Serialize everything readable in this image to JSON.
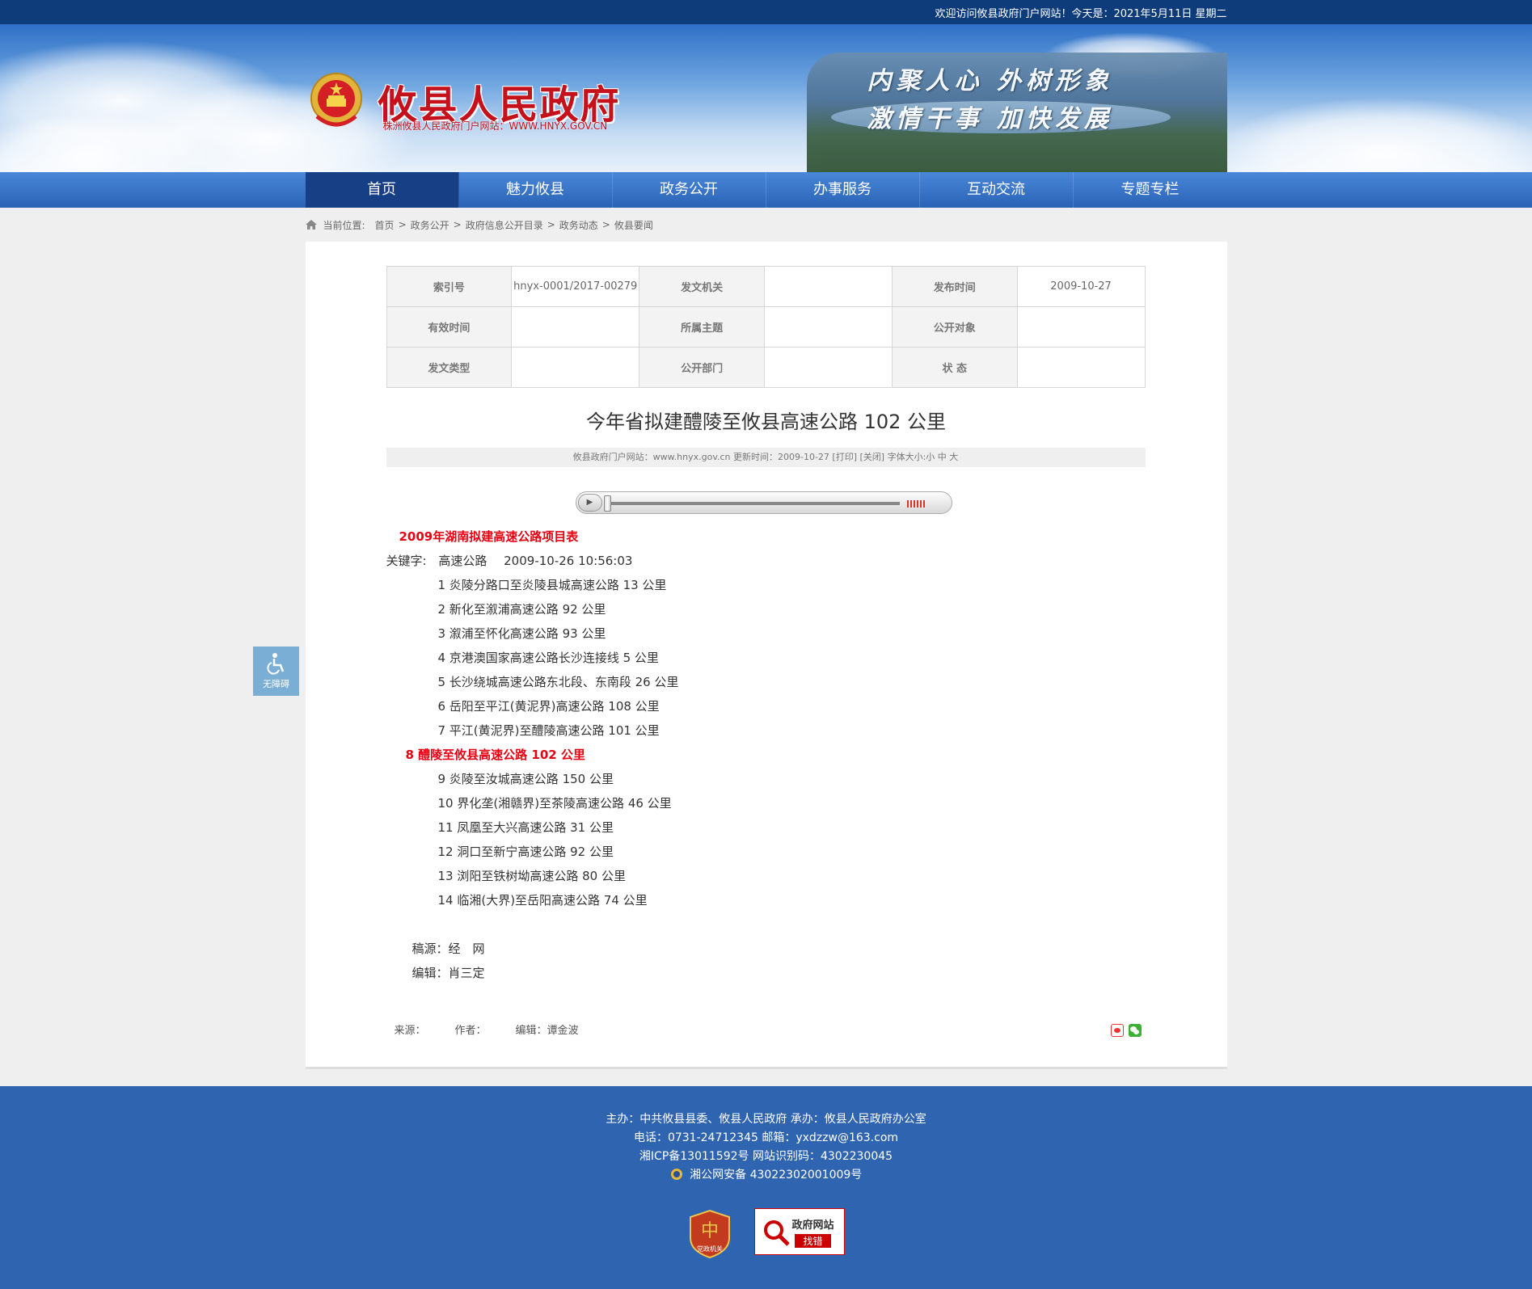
{
  "topbar": {
    "welcome": "欢迎访问攸县政府门户网站！今天是：2021年5月11日 星期二"
  },
  "header": {
    "site_title": "攸县人民政府",
    "site_subtitle": "株洲攸县人民政府门户网站：WWW.HNYX.GOV.CN",
    "slogan_line1": "内聚人心  外树形象",
    "slogan_line2": "激情干事  加快发展"
  },
  "nav": {
    "items": [
      {
        "label": "首页"
      },
      {
        "label": "魅力攸县"
      },
      {
        "label": "政务公开"
      },
      {
        "label": "办事服务"
      },
      {
        "label": "互动交流"
      },
      {
        "label": "专题专栏"
      }
    ]
  },
  "breadcrumb": {
    "prefix": "当前位置:",
    "items": [
      "首页",
      "政务公开",
      "政府信息公开目录",
      "政务动态",
      "攸县要闻"
    ],
    "separator": ">"
  },
  "meta": {
    "row1": [
      {
        "label": "索引号",
        "value": "hnyx-0001/2017-00279"
      },
      {
        "label": "发文机关",
        "value": ""
      },
      {
        "label": "发布时间",
        "value": "2009-10-27"
      }
    ],
    "row2": [
      {
        "label": "有效时间",
        "value": ""
      },
      {
        "label": "所属主题",
        "value": ""
      },
      {
        "label": "公开对象",
        "value": ""
      }
    ],
    "row3": [
      {
        "label": "发文类型",
        "value": ""
      },
      {
        "label": "公开部门",
        "value": ""
      },
      {
        "label": "状  态",
        "value": ""
      }
    ]
  },
  "article": {
    "title": "今年省拟建醴陵至攸县高速公路 102 公里",
    "info": "攸县政府门户网站：www.hnyx.gov.cn   更新时间：2009-10-27   [打印]  [关闭]   字体大小:小 中 大",
    "heading": "2009年湖南拟建高速公路项目表",
    "keywords_label": "关键字:",
    "keywords": "高速公路",
    "keywords_time": "2009-10-26 10:56:03",
    "items": [
      "1 炎陵分路口至炎陵县城高速公路 13 公里",
      "2 新化至溆浦高速公路 92 公里",
      "3 溆浦至怀化高速公路 93 公里",
      "4 京港澳国家高速公路长沙连接线 5 公里",
      "5 长沙绕城高速公路东北段、东南段 26 公里",
      "6 岳阳至平江(黄泥界)高速公路 108 公里",
      "7 平江(黄泥界)至醴陵高速公路 101 公里"
    ],
    "highlight_item": "8 醴陵至攸县高速公路 102 公里",
    "items_after": [
      "9 炎陵至汝城高速公路 150 公里",
      "10 界化垄(湘赣界)至茶陵高速公路 46 公里",
      "11 凤凰至大兴高速公路 31 公里",
      "12 洞口至新宁高速公路 92 公里",
      "13 浏阳至铁树坳高速公路 80 公里",
      "14 临湘(大界)至岳阳高速公路 74 公里"
    ],
    "source_line": "稿源：经　网",
    "editor_line": "编辑：肖三定"
  },
  "article_footer": {
    "source": "来源：",
    "author": "作者：",
    "editor": "编辑：谭金波"
  },
  "accessibility": {
    "label": "无障碍"
  },
  "footer": {
    "line1": "主办：中共攸县县委、攸县人民政府 承办：攸县人民政府办公室",
    "line2": "电话：0731-24712345 邮箱：yxdzzw@163.com",
    "line3": "湘ICP备13011592号   网站识别码：4302230045",
    "line4": "湘公网安备 43022302001009号",
    "badge1": "党政机关",
    "badge2_top": "政府网站",
    "badge2_bottom": "找错"
  },
  "colors": {
    "topbar": "#0e3c7a",
    "nav": "#2a63b6",
    "nav_active": "#163f85",
    "title_red": "#c5111b",
    "highlight_red": "#e60012",
    "footer": "#2f64b0"
  }
}
